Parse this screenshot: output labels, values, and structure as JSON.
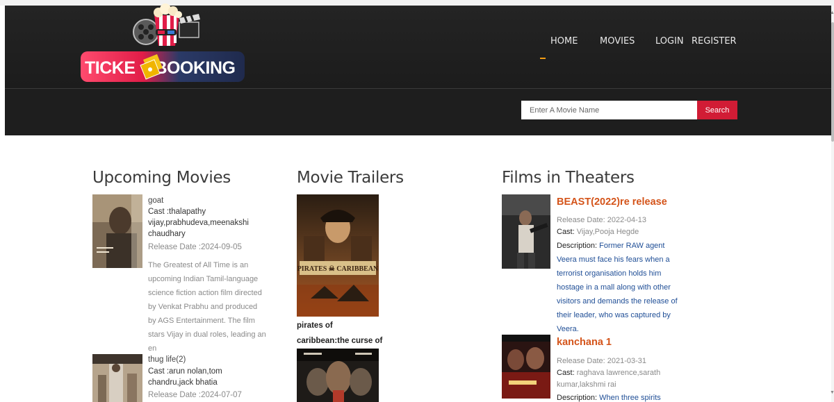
{
  "header": {
    "logo": {
      "text_left": "TICKE",
      "text_right": "BOOKING"
    },
    "nav": [
      {
        "label": "HOME",
        "active": true
      },
      {
        "label": "MOVIES",
        "active": false
      },
      {
        "label": "LOGIN",
        "active": false
      },
      {
        "label": "REGISTER",
        "active": false
      }
    ],
    "search": {
      "placeholder": "Enter A Movie Name",
      "button_label": "Search"
    }
  },
  "upcoming": {
    "title": "Upcoming Movies",
    "movies": [
      {
        "name": "goat",
        "cast_label": "Cast :thalapathy vijay,prabhudeva,meenakshi chaudhary",
        "release": "Release Date :2024-09-05",
        "description": "The Greatest of All Time is an upcoming Indian Tamil-language science fiction action film directed by Venkat Prabhu and produced by AGS Entertainment. The film stars Vijay in dual roles, leading an en"
      },
      {
        "name": "thug life(2)",
        "cast_label": "Cast :arun nolan,tom chandru,jack bhatia",
        "release": "Release Date :2024-07-07"
      }
    ]
  },
  "trailers": {
    "title": "Movie Trailers",
    "items": [
      {
        "caption": "pirates of caribbean:the curse of black pearl",
        "poster_text": "PIRATES CARIBBEAN"
      }
    ]
  },
  "theaters": {
    "title": "Films in Theaters",
    "films": [
      {
        "title": "BEAST(2022)re release",
        "release": "Release Date: 2022-04-13",
        "cast_label": "Cast:",
        "cast": "Vijay,Pooja Hegde",
        "desc_label": "Description:",
        "description": "Former RAW agent Veera must face his fears when a terrorist organisation holds him hostage in a mall along with other visitors and demands the release of their leader, who was captured by Veera."
      },
      {
        "title": "kanchana 1",
        "release": "Release Date: 2021-03-31",
        "cast_label": "Cast:",
        "cast": "raghava lawrence,sarath kumar,lakshmi rai",
        "desc_label": "Description:",
        "description": "When three spirits"
      }
    ]
  },
  "colors": {
    "header_bg": "#1e1e1e",
    "accent_red": "#d11c35",
    "nav_active_underline": "#f39c12",
    "film_title": "#d4541a",
    "description_blue": "#1f4e96"
  }
}
